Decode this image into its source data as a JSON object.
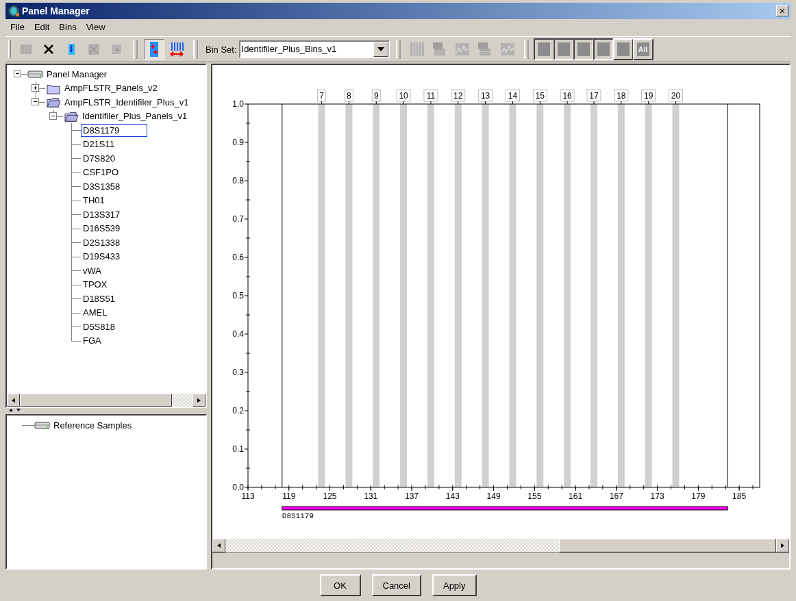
{
  "window": {
    "title": "Panel Manager",
    "close": "×"
  },
  "menu": [
    {
      "label": "File"
    },
    {
      "label": "Edit"
    },
    {
      "label": "Bins"
    },
    {
      "label": "View"
    }
  ],
  "toolbar": {
    "left_buttons": [
      {
        "kind": "grid",
        "disabled": true,
        "pressed": false
      },
      {
        "kind": "delete",
        "disabled": false,
        "pressed": false
      },
      {
        "kind": "stack",
        "disabled": false,
        "pressed": false
      },
      {
        "kind": "xbox",
        "disabled": true,
        "pressed": false
      },
      {
        "kind": "pointer",
        "disabled": true,
        "pressed": false
      }
    ],
    "mode_buttons": [
      {
        "kind": "addbin",
        "disabled": false,
        "pressed": true
      },
      {
        "kind": "resize",
        "disabled": false,
        "pressed": false
      }
    ],
    "bin_set": {
      "label": "Bin Set:",
      "value": "Identifiler_Plus_Bins_v1"
    },
    "right_buttons": [
      {
        "kind": "grid",
        "disabled": true,
        "pressed": false
      },
      {
        "kind": "table",
        "disabled": true,
        "pressed": false
      },
      {
        "kind": "peaks",
        "disabled": true,
        "pressed": false
      },
      {
        "kind": "table",
        "disabled": true,
        "pressed": false
      },
      {
        "kind": "peaks",
        "disabled": true,
        "pressed": false
      }
    ],
    "dye_buttons": [
      {
        "pressed": true
      },
      {
        "pressed": true
      },
      {
        "pressed": true
      },
      {
        "pressed": true
      },
      {
        "pressed": false
      },
      {
        "pressed": false,
        "label": "All"
      }
    ]
  },
  "tree": [
    {
      "label": "Panel Manager",
      "kind": "drive",
      "expanded": true,
      "selected": false,
      "children": [
        {
          "label": "AmpFLSTR_Panels_v2",
          "kind": "folder",
          "expanded": false,
          "selected": false
        },
        {
          "label": "AmpFLSTR_Identifiler_Plus_v1",
          "kind": "folder",
          "expanded": true,
          "selected": false,
          "children": [
            {
              "label": "Identifiler_Plus_Panels_v1",
              "kind": "folder",
              "expanded": true,
              "selected": false,
              "children": [
                {
                  "label": "D8S1179",
                  "selected": true
                },
                {
                  "label": "D21S11",
                  "selected": false
                },
                {
                  "label": "D7S820",
                  "selected": false
                },
                {
                  "label": "CSF1PO",
                  "selected": false
                },
                {
                  "label": "D3S1358",
                  "selected": false
                },
                {
                  "label": "TH01",
                  "selected": false
                },
                {
                  "label": "D13S317",
                  "selected": false
                },
                {
                  "label": "D16S539",
                  "selected": false
                },
                {
                  "label": "D2S1338",
                  "selected": false
                },
                {
                  "label": "D19S433",
                  "selected": false
                },
                {
                  "label": "vWA",
                  "selected": false
                },
                {
                  "label": "TPOX",
                  "selected": false
                },
                {
                  "label": "D18S51",
                  "selected": false
                },
                {
                  "label": "AMEL",
                  "selected": false
                },
                {
                  "label": "D5S818",
                  "selected": false
                },
                {
                  "label": "FGA",
                  "selected": false
                }
              ]
            }
          ]
        }
      ]
    }
  ],
  "reference_tree": [
    {
      "label": "Reference Samples",
      "kind": "drive",
      "selected": false
    }
  ],
  "chart_data": {
    "type": "bar",
    "x": [
      123.8,
      127.8,
      131.8,
      135.8,
      139.8,
      143.8,
      147.8,
      151.8,
      155.8,
      159.8,
      163.7,
      167.7,
      171.7,
      175.7
    ],
    "series": [
      {
        "color": "#d0d0d0",
        "values": [
          1,
          1,
          1,
          1,
          1,
          1,
          1,
          1,
          1,
          1,
          1,
          1,
          1,
          1
        ]
      }
    ],
    "value_labels": [
      "7",
      "8",
      "9",
      "10",
      "11",
      "12",
      "13",
      "14",
      "15",
      "16",
      "17",
      "18",
      "19",
      "20"
    ],
    "xlim": [
      113,
      188
    ],
    "ylim": [
      0,
      1
    ],
    "xticks": [
      113,
      119,
      125,
      131,
      137,
      143,
      149,
      155,
      161,
      167,
      173,
      179,
      185
    ],
    "yticks": [
      {
        "value": 0,
        "label": "0.0"
      },
      {
        "value": 0.1,
        "label": "0.1"
      },
      {
        "value": 0.2,
        "label": "0.2"
      },
      {
        "value": 0.3,
        "label": "0.3"
      },
      {
        "value": 0.4,
        "label": "0.4"
      },
      {
        "value": 0.5,
        "label": "0.5"
      },
      {
        "value": 0.6,
        "label": "0.6"
      },
      {
        "value": 0.7,
        "label": "0.7"
      },
      {
        "value": 0.8,
        "label": "0.8"
      },
      {
        "value": 0.9,
        "label": "0.9"
      },
      {
        "value": 1,
        "label": "1.0"
      }
    ],
    "ref_lines": [
      {
        "axis": "x",
        "value": 118
      },
      {
        "axis": "x",
        "value": 183.3
      }
    ]
  },
  "marker_range": {
    "label": "D8S1179"
  },
  "buttons": [
    {
      "label": "OK"
    },
    {
      "label": "Cancel"
    },
    {
      "label": "Apply"
    }
  ]
}
